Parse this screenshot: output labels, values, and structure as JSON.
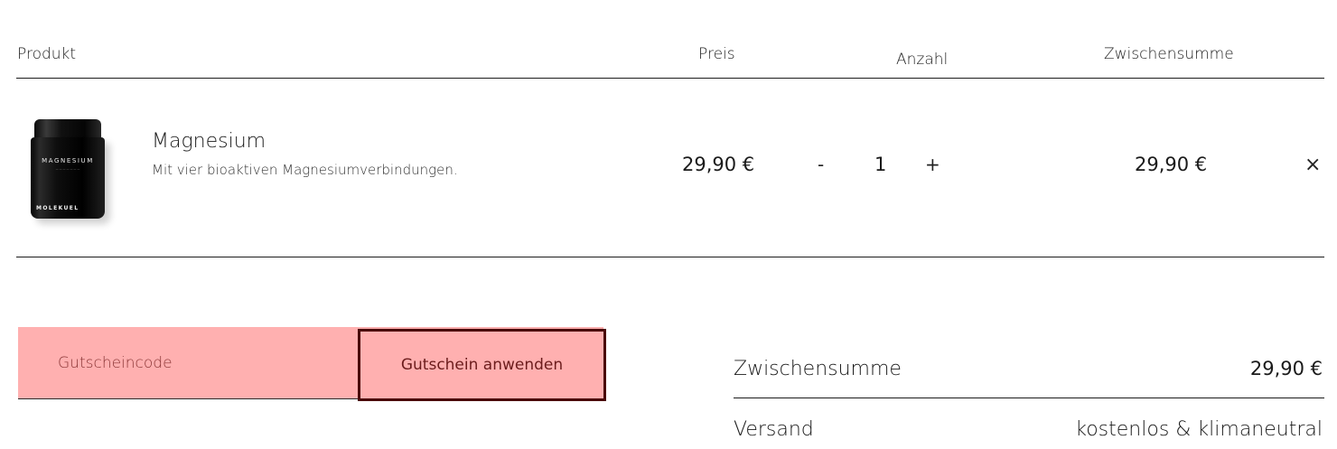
{
  "table": {
    "headers": {
      "product": "Produkt",
      "price": "Preis",
      "quantity": "Anzahl",
      "subtotal": "Zwischensumme"
    },
    "items": [
      {
        "image_label": "MAGNESIUM",
        "image_brand": "MOLEKUEL",
        "name": "Magnesium",
        "description": "Mit vier bioaktiven Magnesiumverbindungen.",
        "price": "29,90 €",
        "decrease_label": "-",
        "quantity": "1",
        "increase_label": "+",
        "subtotal": "29,90 €",
        "remove_icon": "close-icon",
        "remove_glyph": "×"
      }
    ]
  },
  "coupon": {
    "placeholder": "Gutscheincode",
    "value": "",
    "apply_label": "Gutschein anwenden"
  },
  "totals": {
    "subtotal_label": "Zwischensumme",
    "subtotal_value": "29,90 €",
    "shipping_label": "Versand",
    "shipping_value": "kostenlos & klimaneutral"
  },
  "colors": {
    "coupon_bg": "#ffb0b0",
    "button_border": "#4a0a0a"
  }
}
